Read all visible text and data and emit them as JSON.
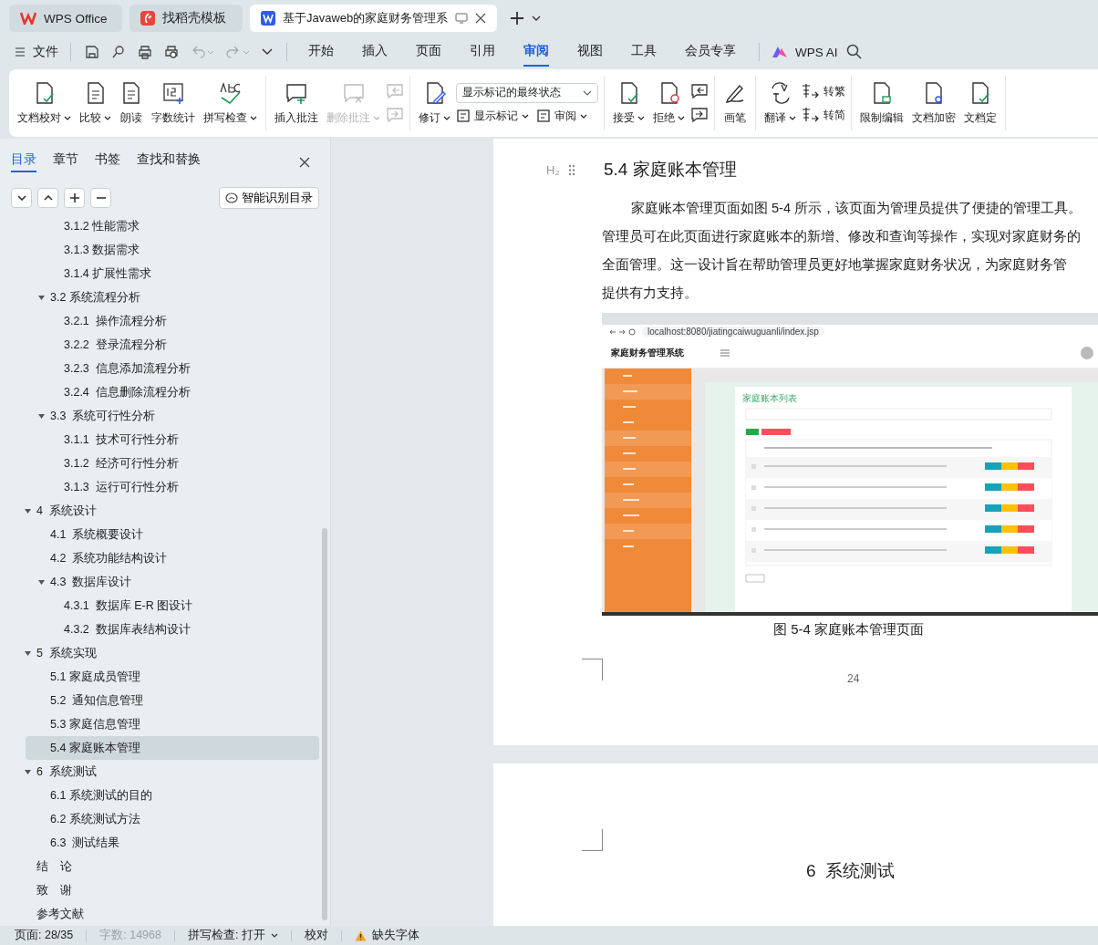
{
  "window_tabs": [
    {
      "label": "WPS Office",
      "selected": false
    },
    {
      "label": "找稻壳模板",
      "selected": false
    },
    {
      "label": "基于Javaweb的家庭财务管理系",
      "selected": true
    }
  ],
  "menu": {
    "file": "文件",
    "tabs": [
      {
        "label": "开始",
        "selected": false
      },
      {
        "label": "插入",
        "selected": false
      },
      {
        "label": "页面",
        "selected": false
      },
      {
        "label": "引用",
        "selected": false
      },
      {
        "label": "审阅",
        "selected": true
      },
      {
        "label": "视图",
        "selected": false
      },
      {
        "label": "工具",
        "selected": false
      },
      {
        "label": "会员专享",
        "selected": false
      }
    ],
    "ai": "WPS AI"
  },
  "ribbon": [
    {
      "columns": [
        {
          "kind": "large",
          "label": "文档校对",
          "dropdown": true,
          "disabled": false
        },
        {
          "kind": "large",
          "label": "比较",
          "dropdown": true,
          "disabled": false
        },
        {
          "kind": "large",
          "label": "朗读",
          "dropdown": false,
          "disabled": false
        },
        {
          "kind": "large",
          "label": "字数统计",
          "dropdown": false,
          "disabled": false
        },
        {
          "kind": "large",
          "label": "拼写检查",
          "dropdown": true,
          "disabled": false
        }
      ]
    },
    {
      "columns": [
        {
          "kind": "large",
          "label": "插入批注",
          "dropdown": false,
          "disabled": false
        },
        {
          "kind": "large",
          "label": "删除批注",
          "dropdown": true,
          "disabled": true
        },
        {
          "kind": "stack",
          "items": [
            {
              "disabled": true
            },
            {
              "disabled": true
            }
          ]
        }
      ]
    },
    {
      "columns": [
        {
          "kind": "large",
          "label": "修订",
          "dropdown": true,
          "disabled": false
        },
        {
          "kind": "markup",
          "select": "显示标记的最终状态",
          "items": [
            {
              "label": "显示标记",
              "dropdown": true,
              "disabled": false
            },
            {
              "label": "审阅",
              "dropdown": true,
              "disabled": false
            }
          ]
        }
      ]
    },
    {
      "columns": [
        {
          "kind": "large",
          "label": "接受",
          "dropdown": true,
          "disabled": false
        },
        {
          "kind": "large",
          "label": "拒绝",
          "dropdown": true,
          "disabled": false
        },
        {
          "kind": "stack",
          "items": [
            {
              "disabled": false
            },
            {
              "disabled": false
            }
          ]
        }
      ]
    },
    {
      "columns": [
        {
          "kind": "large",
          "label": "画笔",
          "dropdown": false,
          "disabled": false
        }
      ]
    },
    {
      "columns": [
        {
          "kind": "large",
          "label": "翻译",
          "dropdown": true,
          "disabled": false
        },
        {
          "kind": "stack",
          "items": [
            {
              "label": "转繁",
              "disabled": false
            },
            {
              "label": "转简",
              "disabled": false
            }
          ]
        }
      ]
    },
    {
      "columns": [
        {
          "kind": "large",
          "label": "限制编辑",
          "dropdown": false,
          "disabled": false
        },
        {
          "kind": "large",
          "label": "文档加密",
          "dropdown": false,
          "disabled": false
        },
        {
          "kind": "large",
          "label": "文档定",
          "dropdown": false,
          "disabled": false
        }
      ]
    }
  ],
  "nav_panel": {
    "tabs": [
      {
        "label": "目录",
        "selected": true
      },
      {
        "label": "章节",
        "selected": false
      },
      {
        "label": "书签",
        "selected": false
      },
      {
        "label": "查找和替换",
        "selected": false
      }
    ],
    "smart_button": "智能识别目录",
    "toc_scrolled_level2": [
      {
        "label": "3.1.2 性能需求",
        "selected": false
      },
      {
        "label": "3.1.3 数据需求",
        "selected": false
      },
      {
        "label": "3.1.4 扩展性需求",
        "selected": false
      }
    ],
    "toc_scrolled_level1": [
      {
        "label": "3.2 系统流程分析",
        "selected": false,
        "expanded": true,
        "children": [
          {
            "label": "3.2.1  操作流程分析",
            "selected": false
          },
          {
            "label": "3.2.2  登录流程分析",
            "selected": false
          },
          {
            "label": "3.2.3  信息添加流程分析",
            "selected": false
          },
          {
            "label": "3.2.4  信息删除流程分析",
            "selected": false
          }
        ]
      },
      {
        "label": "3.3  系统可行性分析",
        "selected": false,
        "expanded": true,
        "children": [
          {
            "label": "3.1.1  技术可行性分析",
            "selected": false
          },
          {
            "label": "3.1.2  经济可行性分析",
            "selected": false
          },
          {
            "label": "3.1.3  运行可行性分析",
            "selected": false
          }
        ]
      }
    ],
    "toc": [
      {
        "label": "4  系统设计",
        "selected": false,
        "expanded": true,
        "children": [
          {
            "label": "4.1  系统概要设计",
            "selected": false
          },
          {
            "label": "4.2  系统功能结构设计",
            "selected": false
          },
          {
            "label": "4.3  数据库设计",
            "selected": false,
            "expanded": true,
            "children": [
              {
                "label": "4.3.1  数据库 E-R 图设计",
                "selected": false
              },
              {
                "label": "4.3.2  数据库表结构设计",
                "selected": false
              }
            ]
          }
        ]
      },
      {
        "label": "5  系统实现",
        "selected": false,
        "expanded": true,
        "children": [
          {
            "label": "5.1 家庭成员管理",
            "selected": false
          },
          {
            "label": "5.2  通知信息管理",
            "selected": false
          },
          {
            "label": "5.3 家庭信息管理",
            "selected": false
          },
          {
            "label": "5.4 家庭账本管理",
            "selected": true
          }
        ]
      },
      {
        "label": "6  系统测试",
        "selected": false,
        "expanded": true,
        "children": [
          {
            "label": "6.1 系统测试的目的",
            "selected": false
          },
          {
            "label": "6.2 系统测试方法",
            "selected": false
          },
          {
            "label": "6.3  测试结果",
            "selected": false
          }
        ]
      },
      {
        "label": "结　论",
        "selected": false
      },
      {
        "label": "致　谢",
        "selected": false
      },
      {
        "label": "参考文献",
        "selected": false
      }
    ]
  },
  "document": {
    "heading_marker": "H₂",
    "heading": "5.4 家庭账本管理",
    "paragraph_lines": [
      "家庭账本管理页面如图 5-4 所示，该页面为管理员提供了便捷的管理工具。",
      "管理员可在此页面进行家庭账本的新增、修改和查询等操作，实现对家庭财务的",
      "全面管理。这一设计旨在帮助管理员更好地掌握家庭财务状况，为家庭财务管",
      "提供有力支持。"
    ],
    "figure": {
      "url": "localhost:8080/jiatingcaiwuguanli/index.jsp",
      "app_title": "家庭财务管理系统",
      "card_title": "家庭账本列表"
    },
    "caption": "图 5-4  家庭账本管理页面",
    "page_number": "24",
    "next_heading": "6  系统测试"
  },
  "status_bar": [
    {
      "kind": "text",
      "label": "页面: 28/35",
      "disabled": false,
      "dropdown": false
    },
    {
      "kind": "text",
      "label": "字数: 14968",
      "disabled": true,
      "dropdown": false
    },
    {
      "kind": "text",
      "label": "拼写检查: 打开",
      "disabled": false,
      "dropdown": true
    },
    {
      "kind": "text",
      "label": "校对",
      "disabled": false,
      "dropdown": false
    },
    {
      "kind": "warning",
      "label": "缺失字体",
      "disabled": false,
      "dropdown": false
    }
  ]
}
